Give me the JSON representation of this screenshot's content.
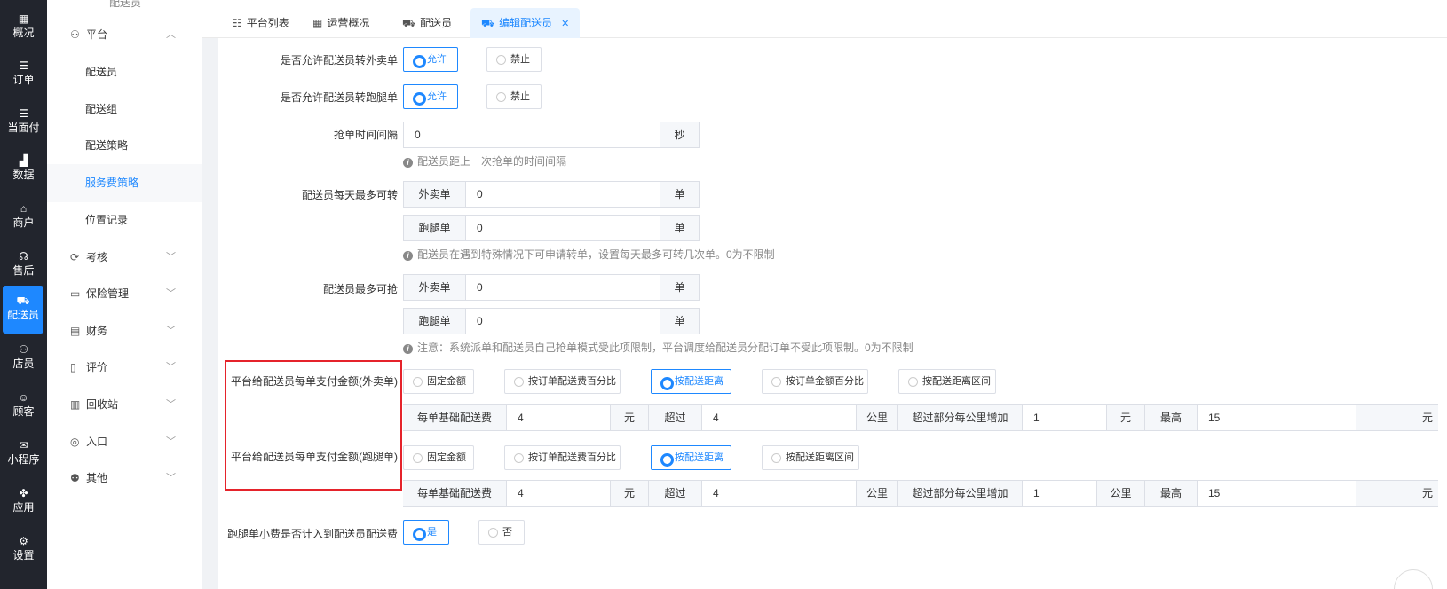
{
  "rail": {
    "items": [
      {
        "icon": "dashboard-icon",
        "glyph": "▦",
        "label": "概况"
      },
      {
        "icon": "list-icon",
        "glyph": "☰",
        "label": "订单"
      },
      {
        "icon": "list-icon",
        "glyph": "☰",
        "label": "当面付"
      },
      {
        "icon": "bar-chart-icon",
        "glyph": "▟",
        "label": "数据"
      },
      {
        "icon": "store-icon",
        "glyph": "⌂",
        "label": "商户"
      },
      {
        "icon": "headset-icon",
        "glyph": "☊",
        "label": "售后"
      },
      {
        "icon": "scooter-icon",
        "glyph": "⛟",
        "label": "配送员"
      },
      {
        "icon": "user-icon",
        "glyph": "⚇",
        "label": "店员"
      },
      {
        "icon": "customer-icon",
        "glyph": "☺",
        "label": "顾客"
      },
      {
        "icon": "wechat-icon",
        "glyph": "✉",
        "label": "小程序"
      },
      {
        "icon": "apps-icon",
        "glyph": "✤",
        "label": "应用"
      },
      {
        "icon": "settings-icon",
        "glyph": "⚙",
        "label": "设置"
      }
    ]
  },
  "menu": {
    "top_partial": "配送员",
    "platform": {
      "label": "平台",
      "icon": "users-icon"
    },
    "subitems": [
      "配送员",
      "配送组",
      "配送策略",
      "服务费策略",
      "位置记录"
    ],
    "active_sub": "服务费策略",
    "groups": [
      {
        "label": "考核",
        "icon": "refresh-icon",
        "glyph": "⟳"
      },
      {
        "label": "保险管理",
        "icon": "laptop-icon",
        "glyph": "▭"
      },
      {
        "label": "财务",
        "icon": "wallet-icon",
        "glyph": "▤"
      },
      {
        "label": "评价",
        "icon": "document-icon",
        "glyph": "▯"
      },
      {
        "label": "回收站",
        "icon": "trash-icon",
        "glyph": "▥"
      },
      {
        "label": "入口",
        "icon": "compass-icon",
        "glyph": "◎"
      },
      {
        "label": "其他",
        "icon": "user-plus-icon",
        "glyph": "⚉"
      }
    ]
  },
  "tabs": [
    {
      "label": "平台列表",
      "icon": "list-icon",
      "glyph": "☷"
    },
    {
      "label": "运营概况",
      "icon": "grid-icon",
      "glyph": "▦"
    },
    {
      "label": "配送员",
      "icon": "scooter-icon",
      "glyph": "⛟"
    },
    {
      "label": "编辑配送员",
      "icon": "scooter-icon",
      "glyph": "⛟",
      "active": true
    }
  ],
  "form": {
    "allow_takeout": {
      "label": "是否允许配送员转外卖单",
      "opt1": "允许",
      "opt2": "禁止"
    },
    "allow_errand": {
      "label": "是否允许配送员转跑腿单",
      "opt1": "允许",
      "opt2": "禁止"
    },
    "grab_interval": {
      "label": "抢单时间间隔",
      "value": "0",
      "unit": "秒",
      "hint": "配送员距上一次抢单的时间间隔"
    },
    "max_transfer": {
      "label": "配送员每天最多可转",
      "takeout_addon": "外卖单",
      "takeout_value": "0",
      "takeout_unit": "单",
      "errand_addon": "跑腿单",
      "errand_value": "0",
      "errand_unit": "单",
      "hint": "配送员在遇到特殊情况下可申请转单，设置每天最多可转几次单。0为不限制"
    },
    "max_grab": {
      "label": "配送员最多可抢",
      "takeout_addon": "外卖单",
      "takeout_value": "0",
      "takeout_unit": "单",
      "errand_addon": "跑腿单",
      "errand_value": "0",
      "errand_unit": "单",
      "hint": "注意：系统派单和配送员自己抢单模式受此项限制，平台调度给配送员分配订单不受此项限制。0为不限制"
    },
    "pay_takeout": {
      "label": "平台给配送员每单支付金额(外卖单)",
      "options": [
        "固定金额",
        "按订单配送费百分比",
        "按配送距离",
        "按订单金额百分比",
        "按配送距离区间"
      ],
      "selected": "按配送距离",
      "row": {
        "base_label": "每单基础配送费",
        "base_value": "4",
        "base_unit": "元",
        "over_label": "超过",
        "over_value": "4",
        "over_unit": "公里",
        "extra_label": "超过部分每公里增加",
        "extra_value": "1",
        "extra_unit": "元",
        "max_label": "最高",
        "max_value": "15",
        "max_unit": "元"
      }
    },
    "pay_errand": {
      "label": "平台给配送员每单支付金额(跑腿单)",
      "options": [
        "固定金额",
        "按订单配送费百分比",
        "按配送距离",
        "按配送距离区间"
      ],
      "selected": "按配送距离",
      "row": {
        "base_label": "每单基础配送费",
        "base_value": "4",
        "base_unit": "元",
        "over_label": "超过",
        "over_value": "4",
        "over_unit": "公里",
        "extra_label": "超过部分每公里增加",
        "extra_value": "1",
        "extra_unit": "公里",
        "max_label": "最高",
        "max_value": "15",
        "max_unit": "元"
      }
    },
    "tip_included": {
      "label": "跑腿单小费是否计入到配送员配送费",
      "opt1": "是",
      "opt2": "否"
    }
  },
  "colors": {
    "accent": "#1e88ff",
    "rail_bg": "#22252d",
    "highlight_box": "#e5232b"
  }
}
